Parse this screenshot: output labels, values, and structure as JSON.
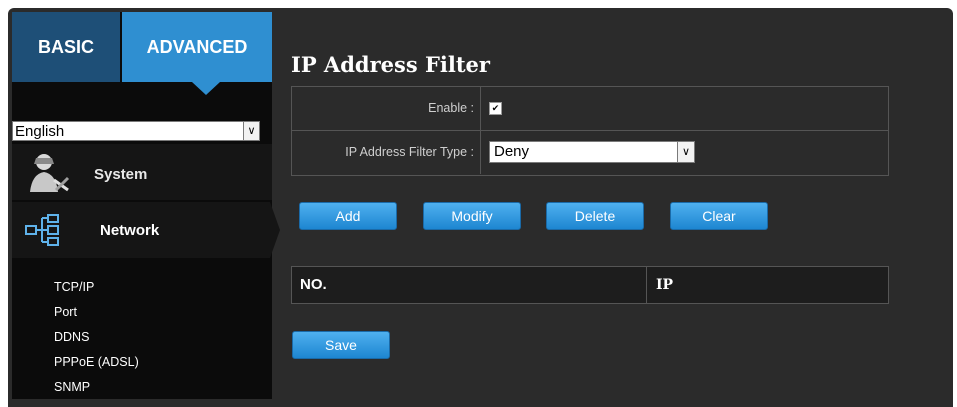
{
  "tabs": {
    "basic": "BASIC",
    "advanced": "ADVANCED"
  },
  "language": {
    "selected": "English"
  },
  "menu": {
    "system": "System",
    "network": "Network",
    "network_items": [
      "TCP/IP",
      "Port",
      "DDNS",
      "PPPoE (ADSL)",
      "SNMP"
    ]
  },
  "page": {
    "title": "IP Address Filter"
  },
  "form": {
    "enable_label": "Enable :",
    "enable_checked": true,
    "filter_type_label": "IP Address Filter Type :",
    "filter_type_value": "Deny"
  },
  "buttons": {
    "add": "Add",
    "modify": "Modify",
    "delete": "Delete",
    "clear": "Clear",
    "save": "Save"
  },
  "table": {
    "columns": [
      "NO.",
      "IP"
    ]
  },
  "colors": {
    "accent": "#2f8fd1",
    "basic_tab": "#1e4f77",
    "background": "#2b2b2b"
  }
}
